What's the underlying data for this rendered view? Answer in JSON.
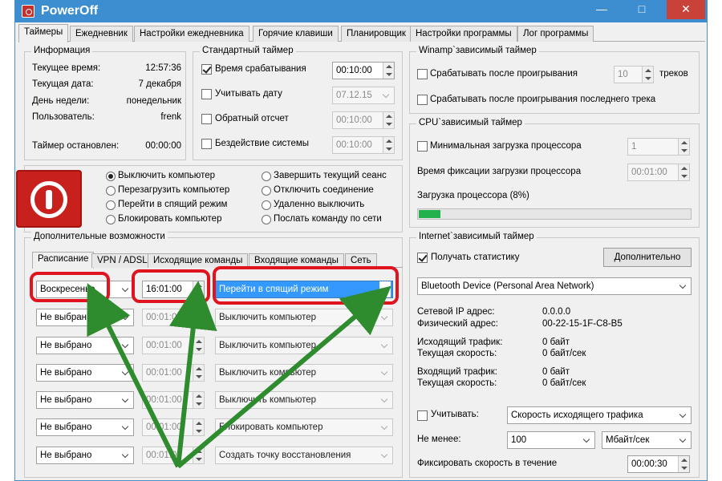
{
  "window": {
    "title": "PowerOff",
    "minimize": "—",
    "maximize": "□",
    "close": "✕"
  },
  "tabs": [
    "Таймеры",
    "Ежедневник",
    "Настройки ежедневника",
    "Горячие клавиши",
    "Планировщик",
    "Настройки программы",
    "Лог программы"
  ],
  "info": {
    "title": "Информация",
    "rows": [
      {
        "label": "Текущее время:",
        "value": "12:57:36"
      },
      {
        "label": "Текущая дата:",
        "value": "7 декабря"
      },
      {
        "label": "День недели:",
        "value": "понедельник"
      },
      {
        "label": "Пользователь:",
        "value": "frenk"
      }
    ],
    "stopped_label": "Таймер остановлен:",
    "stopped_value": "00:00:00"
  },
  "std": {
    "title": "Стандартный таймер",
    "rows": [
      {
        "label": "Время срабатывания",
        "value": "00:10:00",
        "checked": true
      },
      {
        "label": "Учитывать дату",
        "value": "07.12.15",
        "checked": false
      },
      {
        "label": "Обратный отсчет",
        "value": "00:10:00",
        "checked": false
      },
      {
        "label": "Бездействие системы",
        "value": "00:10:00",
        "checked": false
      }
    ]
  },
  "actions": {
    "left": [
      "Выключить компьютер",
      "Перезагрузить компьютер",
      "Перейти в спящий режим",
      "Блокировать компьютер"
    ],
    "right": [
      "Завершить текущий сеанс",
      "Отключить соединение",
      "Удаленно выключить",
      "Послать команду по сети"
    ]
  },
  "winamp": {
    "title": "Winamp`зависимый таймер",
    "after_play": "Срабатывать после проигрывания",
    "tracks_value": "10",
    "tracks_label": "треков",
    "after_last": "Срабатывать после проигрывания последнего трека"
  },
  "cpu": {
    "title": "CPU`зависимый таймер",
    "min_load": "Минимальная загрузка процессора",
    "min_value": "1",
    "fix_time": "Время фиксации загрузки процессора",
    "fix_value": "00:01:00",
    "load_label": "Загрузка процессора (8%)",
    "load_percent": 8
  },
  "extra": {
    "title": "Дополнительные возможности",
    "subtabs": [
      "Расписание",
      "VPN / ADSL",
      "Исходящие команды",
      "Входящие команды",
      "Сеть"
    ],
    "schedule": [
      {
        "day": "Воскресенье",
        "time": "16:01:00",
        "action": "Перейти в спящий режим"
      },
      {
        "day": "Не выбрано",
        "time": "00:01:00",
        "action": "Выключить компьютер"
      },
      {
        "day": "Не выбрано",
        "time": "00:01:00",
        "action": "Выключить компьютер"
      },
      {
        "day": "Не выбрано",
        "time": "00:01:00",
        "action": "Выключить компьютер"
      },
      {
        "day": "Не выбрано",
        "time": "00:01:00",
        "action": "Выключить компьютер"
      },
      {
        "day": "Не выбрано",
        "time": "00:01:00",
        "action": "Блокировать компьютер"
      },
      {
        "day": "Не выбрано",
        "time": "00:01:00",
        "action": "Создать точку восстановления"
      }
    ]
  },
  "internet": {
    "title": "Internet`зависимый таймер",
    "get_stats": "Получать статистику",
    "more_button": "Дополнительно",
    "device": "Bluetooth Device (Personal Area Network)",
    "rows": [
      {
        "label": "Сетевой IP адрес:",
        "value": "0.0.0.0"
      },
      {
        "label": "Физический адрес:",
        "value": "00-22-15-1F-C8-B5"
      },
      {
        "label": "Исходящий трафик:",
        "value": "0 байт"
      },
      {
        "label": "Текущая скорость:",
        "value": "0 байт/сек"
      },
      {
        "label": "Входящий трафик:",
        "value": "0 байт"
      },
      {
        "label": "Текущая скорость:",
        "value": "0 байт/сек"
      }
    ],
    "consider_label": "Учитывать:",
    "consider_value": "Скорость исходящего трафика",
    "not_less_label": "Не менее:",
    "not_less_value": "100",
    "unit_value": "Мбайт/сек",
    "fix_label": "Фиксировать скорость в течение",
    "fix_value": "00:00:30"
  },
  "colors": {
    "highlight": "#e0141e",
    "arrow": "#2e8b2e",
    "accent": "#3d8ed0",
    "progress": "#22b14c"
  }
}
